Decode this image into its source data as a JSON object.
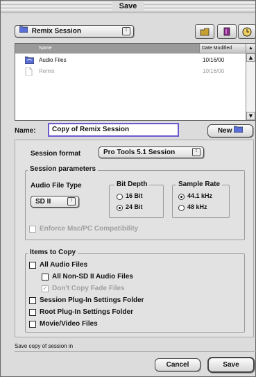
{
  "window": {
    "title": "Save"
  },
  "location": {
    "selected": "Remix Session",
    "arrows": "↕"
  },
  "toolbar": {
    "desktop_button": "desktop-folder",
    "bookmarks_button": "bookmarks",
    "recent_button": "recent-items"
  },
  "files": {
    "columns": {
      "name": "Name",
      "date": "Date Modified",
      "sort": "▲"
    },
    "rows": [
      {
        "name": "Audio Files",
        "date": "10/16/00",
        "icon": "folder-icon",
        "enabled": true
      },
      {
        "name": "Remix",
        "date": "10/16/00",
        "icon": "document-icon",
        "enabled": false
      }
    ],
    "scroll_up": "▲",
    "scroll_down": "▼"
  },
  "name_field": {
    "label": "Name:",
    "value": "Copy of Remix Session"
  },
  "new_button": {
    "label": "New"
  },
  "session_format": {
    "label": "Session format",
    "selected": "Pro Tools 5.1 Session"
  },
  "session_parameters": {
    "title": "Session parameters",
    "audio_file_type": {
      "label": "Audio File Type",
      "selected": "SD II"
    },
    "bit_depth": {
      "title": "Bit Depth",
      "options": [
        "16 Bit",
        "24 Bit"
      ],
      "selected": "24 Bit"
    },
    "sample_rate": {
      "title": "Sample Rate",
      "options": [
        "44.1 kHz",
        "48 kHz"
      ],
      "selected": "44.1 kHz"
    },
    "enforce_compat": {
      "label": "Enforce Mac/PC Compatibility",
      "checked": false,
      "enabled": false
    }
  },
  "items_to_copy": {
    "title": "Items to Copy",
    "all_audio_files": {
      "label": "All Audio Files",
      "checked": false
    },
    "all_non_sd2": {
      "label": "All Non-SD II Audio Files",
      "checked": false
    },
    "dont_copy_fade": {
      "label": "Don't Copy Fade Files",
      "checked": true,
      "enabled": false
    },
    "session_plugin": {
      "label": "Session Plug-In Settings Folder",
      "checked": false
    },
    "root_plugin": {
      "label": "Root Plug-In Settings Folder",
      "checked": false
    },
    "movie_video": {
      "label": "Movie/Video Files",
      "checked": false
    }
  },
  "status_text": "Save copy of session in",
  "buttons": {
    "cancel": "Cancel",
    "save": "Save"
  },
  "colors": {
    "name_field_border": "#6a5acd",
    "folder": "#5a6fd6"
  }
}
